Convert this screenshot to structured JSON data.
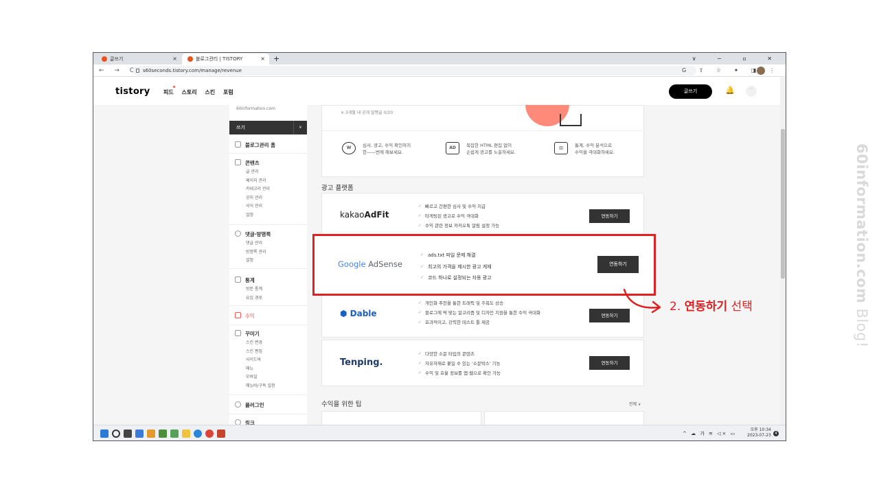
{
  "browser": {
    "tabs": [
      {
        "label": "글쓰기",
        "close": "×"
      },
      {
        "label": "블로그관리 | TISTORY",
        "close": "×"
      }
    ],
    "new_tab": "+",
    "window_controls": "∨ − ▫ ✕",
    "nav_buttons": "← → C",
    "url": "s60seconds.tistory.com/manage/revenue",
    "toolbar_icons": "G ⇪ ☆ ✦ ◨ ⋮"
  },
  "header": {
    "logo": "tistory",
    "nav": [
      "피드",
      "스토리",
      "스킨",
      "포럼"
    ],
    "write_button": "글쓰기",
    "bell": "🔔"
  },
  "sidebar": {
    "blog_url": "60information.com",
    "write": "쓰기",
    "write_caret": "∨",
    "home": "블로그관리 홈",
    "sections": [
      {
        "title": "콘텐츠",
        "items": [
          "글 관리",
          "페이지 관리",
          "카테고리 관리",
          "공지 관리",
          "서식 관리",
          "설정"
        ]
      },
      {
        "title": "댓글·방명록",
        "items": [
          "댓글 관리",
          "방명록 관리",
          "설정"
        ]
      },
      {
        "title": "통계",
        "items": [
          "방문 통계",
          "유입 경로"
        ]
      },
      {
        "title": "수익",
        "items": []
      },
      {
        "title": "꾸미기",
        "items": [
          "스킨 변경",
          "스킨 편집",
          "사이드바",
          "메뉴",
          "모바일",
          "메뉴바/구독 설정"
        ]
      },
      {
        "title": "플러그인",
        "items": []
      },
      {
        "title": "링크",
        "items": []
      }
    ]
  },
  "main": {
    "banner_text": "✕  3개월 내 공개 발행글 0/20",
    "features": [
      {
        "icon": "W",
        "line1": "심사, 광고, 수익 확인까지",
        "line2": "한——번에 해보세요."
      },
      {
        "icon": "AD",
        "line1": "복잡한 HTML 편집 없이",
        "line2": "손쉽게 광고를 노출하세요."
      },
      {
        "icon": "▥",
        "line1": "통계, 수익 분석으로",
        "line2": "수익을 극대화하세요."
      }
    ],
    "platform_title": "광고 플랫폼",
    "platforms": [
      {
        "name": "kakaoAdFit",
        "name_prefix": "kakao",
        "name_bold": "AdFit",
        "features": [
          "빠르고 간편한 심사 및 수익 지급",
          "타게팅된 광고로 수익 극대화",
          "수익 관련 정보 카카오톡 알림 설정 가능"
        ],
        "button": "연동하기"
      },
      {
        "name": "Google AdSense",
        "name_prefix": "Google",
        "name_bold": "AdSense",
        "features": [
          "ads.txt 파일 문제 해결",
          "최고의 가격을 제시한 광고 게재",
          "코드 하나로 설정되는 자동 광고"
        ],
        "button": "연동하기"
      },
      {
        "name": "Dable",
        "name_prefix": "",
        "name_bold": "Dable",
        "features": [
          "개인화 추천을 통한 트래픽 및 주목도 상승",
          "블로그에 딱 맞는 알고리즘 및 디자인 지원을 통한 수익 극대화",
          "효과적이고, 강력한 테스트 툴 제공"
        ],
        "button": "연동하기"
      },
      {
        "name": "Tenping.",
        "name_prefix": "",
        "name_bold": "Tenping.",
        "features": [
          "다양한 소문 타입의 콘텐츠",
          "자유자재로 붙일 수 있는 '소문박스' 기능",
          "수익 및 효율 정보를 앱·웹으로 확인 가능"
        ],
        "button": "연동하기"
      }
    ],
    "tips_title": "수익을 위한 팁",
    "tips_all": "전체 ∨"
  },
  "taskbar": {
    "tray": "^ ☁ 가 ≋ ◁× ▭",
    "clock_line1": "오후 10:34",
    "clock_line2": "2023-07-23",
    "notif": "4"
  },
  "annotation": {
    "prefix": "2. ",
    "bold": "연동하기",
    "suffix": " 선택"
  },
  "watermark": {
    "bold": "60information.com",
    "thin": " Blog!"
  },
  "colors": {
    "highlight": "#e02020",
    "button": "#333333",
    "accent": "#ff5544"
  }
}
